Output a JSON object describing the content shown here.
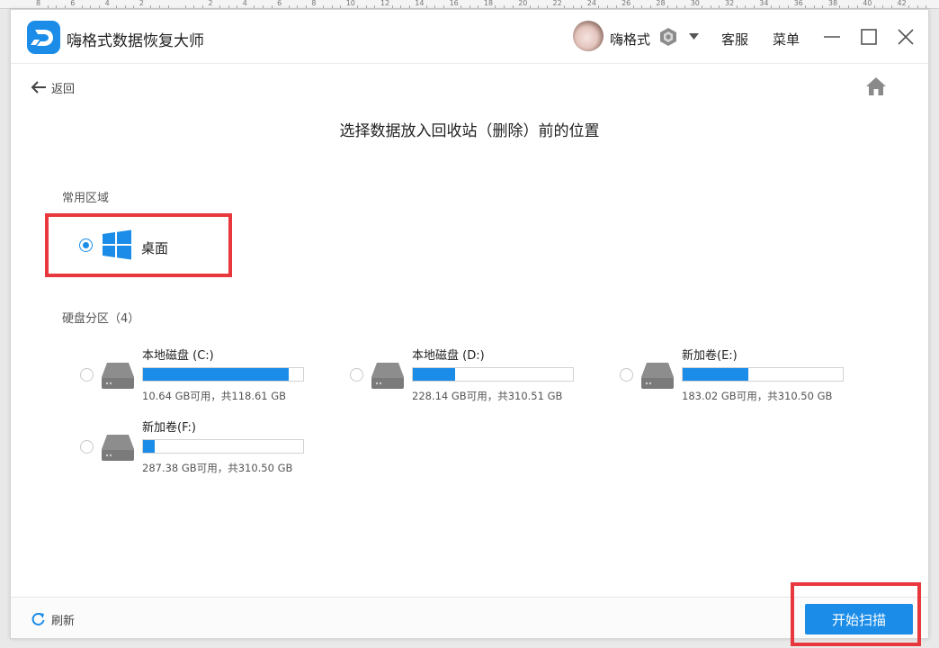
{
  "ruler": {
    "labels": [
      "8",
      "6",
      "4",
      "2",
      "",
      "2",
      "4",
      "6",
      "8",
      "10",
      "12",
      "14",
      "16",
      "18",
      "20",
      "22",
      "24",
      "26",
      "28",
      "30",
      "32",
      "34",
      "36",
      "38",
      "40",
      "42"
    ]
  },
  "titlebar": {
    "app_name": "嗨格式数据恢复大师",
    "username": "嗨格式",
    "service_label": "客服",
    "menu_label": "菜单"
  },
  "nav": {
    "back_label": "返回"
  },
  "main": {
    "title": "选择数据放入回收站（删除）前的位置",
    "common_section_label": "常用区域",
    "desktop_label": "桌面",
    "disk_section_label": "硬盘分区（4）",
    "drives": [
      {
        "name": "本地磁盘 (C:)",
        "info": "10.64 GB可用，共118.61 GB",
        "used_fraction": 0.91
      },
      {
        "name": "本地磁盘 (D:)",
        "info": "228.14 GB可用，共310.51 GB",
        "used_fraction": 0.265
      },
      {
        "name": "新加卷(E:)",
        "info": "183.02 GB可用，共310.50 GB",
        "used_fraction": 0.41
      },
      {
        "name": "新加卷(F:)",
        "info": "287.38 GB可用，共310.50 GB",
        "used_fraction": 0.075
      }
    ]
  },
  "footer": {
    "refresh_label": "刷新",
    "scan_label": "开始扫描"
  },
  "colors": {
    "accent": "#1b8ce8",
    "highlight": "#e8383d"
  }
}
